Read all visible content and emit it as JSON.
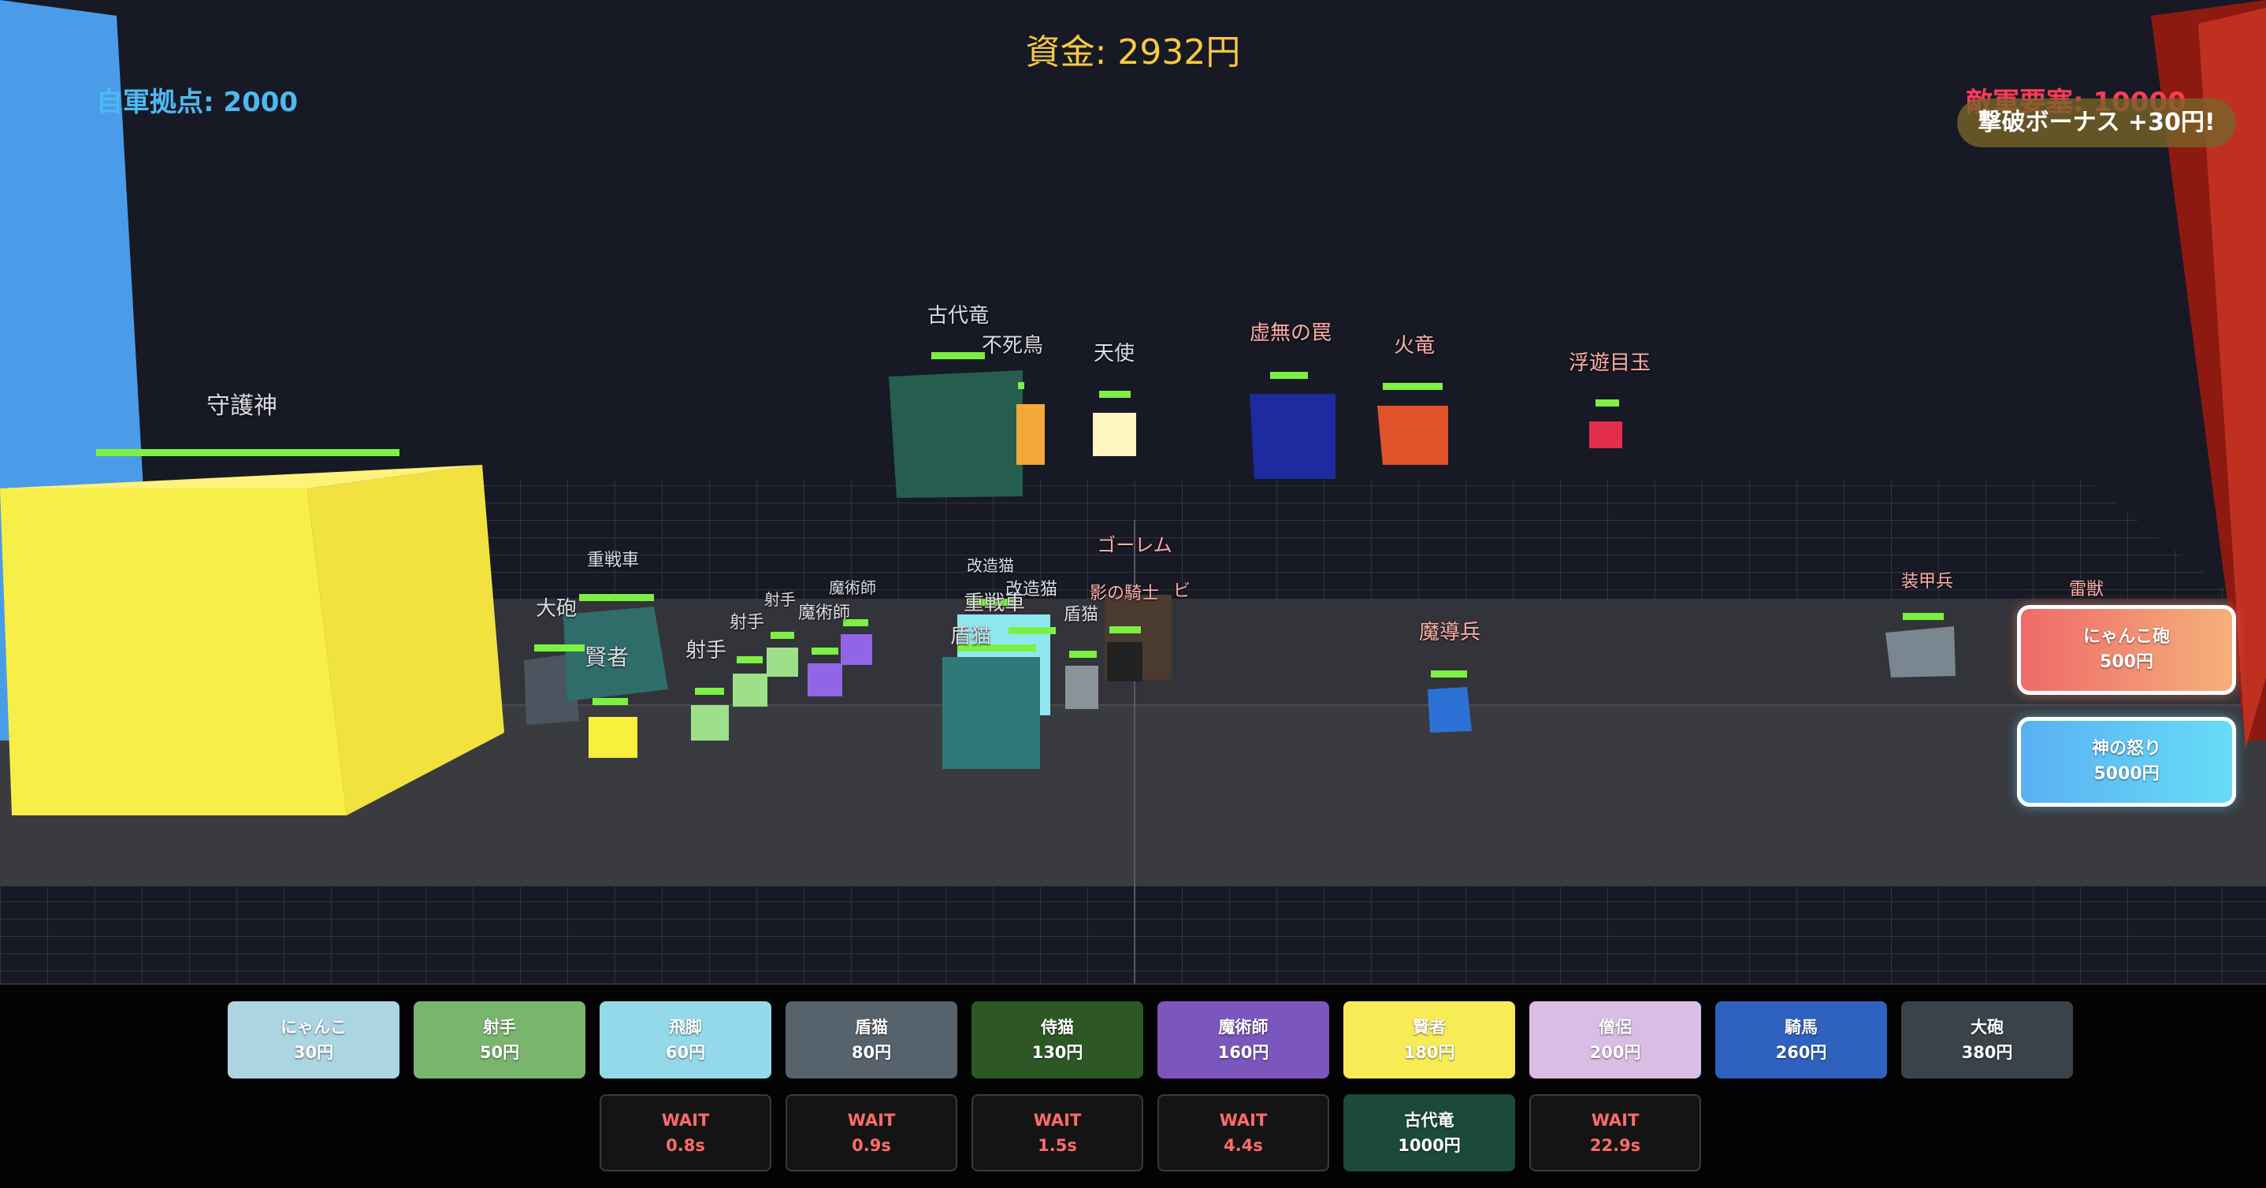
{
  "hud": {
    "funds": "資金: 2932円",
    "ally_base": "自軍拠点: 2000",
    "enemy_base": "敵軍要塞: 10000",
    "bonus": "撃破ボーナス +30円!"
  },
  "labels": {
    "guardian": "守護神",
    "ancient_dragon": "古代竜",
    "phoenix": "不死鳥",
    "angel": "天使",
    "void_trap": "虚無の罠",
    "fire_dragon": "火竜",
    "floating_eye": "浮遊目玉",
    "golem": "ゴーレム",
    "shadow_knight": "影の騎士",
    "zombie": "ビ",
    "armored": "装甲兵",
    "thunder_beast": "雷獣",
    "mage_soldier": "魔導兵",
    "heavy_tank_a": "重戦車",
    "cannon": "大砲",
    "sage": "賢者",
    "archer_a": "射手",
    "archer_b": "射手",
    "archer_c": "射手",
    "wizard_a": "魔術師",
    "wizard_b": "魔術師",
    "cyborg_a": "改造猫",
    "cyborg_b": "改造猫",
    "heavy_tank_b": "重戦車",
    "shield_a": "盾猫",
    "shield_b": "盾猫"
  },
  "units": [
    {
      "name": "にゃんこ",
      "price": "30円",
      "color": "#acd5e2"
    },
    {
      "name": "射手",
      "price": "50円",
      "color": "#7ab56e"
    },
    {
      "name": "飛脚",
      "price": "60円",
      "color": "#94d9ea"
    },
    {
      "name": "盾猫",
      "price": "80円",
      "color": "#56626c"
    },
    {
      "name": "侍猫",
      "price": "130円",
      "color": "#2d5826"
    },
    {
      "name": "魔術師",
      "price": "160円",
      "color": "#7b56bc"
    },
    {
      "name": "賢者",
      "price": "180円",
      "color": "#f7ec55"
    },
    {
      "name": "僧侶",
      "price": "200円",
      "color": "#dabde4"
    },
    {
      "name": "騎馬",
      "price": "260円",
      "color": "#2e62be"
    },
    {
      "name": "大砲",
      "price": "380円",
      "color": "#3a4349"
    }
  ],
  "row2": [
    {
      "state": "WAIT",
      "time": "0.8s"
    },
    {
      "state": "WAIT",
      "time": "0.9s"
    },
    {
      "state": "WAIT",
      "time": "1.5s"
    },
    {
      "state": "WAIT",
      "time": "4.4s"
    },
    {
      "name": "古代竜",
      "price": "1000円",
      "color": "#1c4a3a"
    },
    {
      "state": "WAIT",
      "time": "22.9s"
    }
  ],
  "specials": [
    {
      "name": "にゃんこ砲",
      "price": "500円"
    },
    {
      "name": "神の怒り",
      "price": "5000円"
    }
  ]
}
